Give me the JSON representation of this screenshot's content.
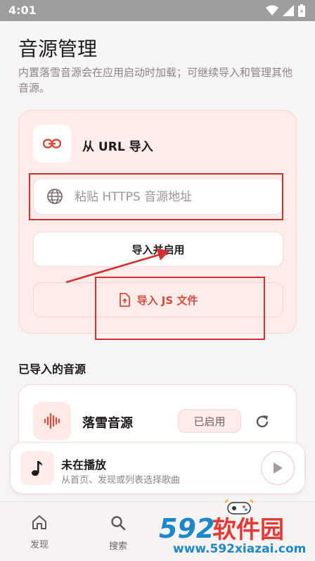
{
  "status_bar": {
    "time": "4:01"
  },
  "page": {
    "title": "音源管理",
    "subtitle": "内置落雪音源会在应用启动时加载；可继续导入和管理其他音源。"
  },
  "import_card": {
    "title": "从 URL 导入",
    "url_placeholder": "粘贴 HTTPS 音源地址",
    "import_enable_label": "导入并启用",
    "import_js_label": "导入 JS 文件"
  },
  "imported_section": {
    "title": "已导入的音源",
    "items": [
      {
        "name": "落雪音源",
        "status": "已启用"
      }
    ]
  },
  "player": {
    "title": "未在播放",
    "subtitle": "从首页、发现或列表选择歌曲"
  },
  "bottom_nav": {
    "items": [
      {
        "label": "发现"
      },
      {
        "label": "搜索"
      }
    ]
  },
  "watermark": {
    "brand": "592软件园",
    "url": "www.592xiazai.com"
  },
  "colors": {
    "accent": "#d8493c",
    "card_bg": "#fdecea",
    "annotation": "#d32f2f"
  }
}
